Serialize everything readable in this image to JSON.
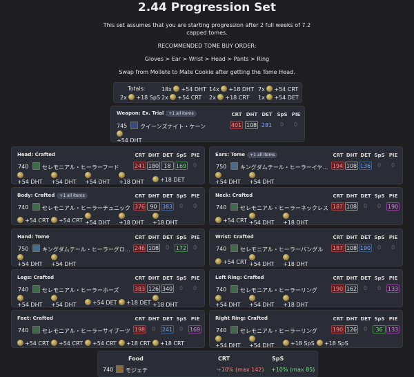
{
  "header": {
    "title": "2.44 Progression Set",
    "line1": "This set assumes that you are starting progression after 2 full weeks of 7.2",
    "line2": "capped tomes.",
    "line3": "RECOMMENDED TOME BUY ORDER:",
    "line4": "Gloves > Ear > Wrist > Head > Pants > Ring",
    "line5": "Swap from Mollete to Mate Cookie after getting the Tome Head."
  },
  "totals": {
    "label": "Totals:",
    "items": [
      "18x",
      "+54 DHT",
      "14x",
      "+18 DHT",
      "7x",
      "+54 CRT",
      "2x",
      "+18 SpS",
      "2x",
      "+54 CRT",
      "2x",
      "+18 CRT",
      "1x",
      "+54 DET"
    ]
  },
  "stat_headers": [
    "CRT",
    "DHT",
    "DET",
    "SpS",
    "PIE"
  ],
  "weapon": {
    "slot": "Weapon: Ex. Trial",
    "badge": "+1 all items",
    "ilvl": "745",
    "name": "クイーンズナイト・ケーン",
    "stats": [
      "401",
      "108",
      "281",
      "0",
      "0"
    ],
    "melds": [
      "+54 DHT"
    ]
  },
  "gear": [
    {
      "slot": "Head: Crafted",
      "ilvl": "740",
      "name": "セレモニアル・ヒーラーフード",
      "stats": [
        "241",
        "180",
        "18",
        "169",
        "0"
      ],
      "melds": [
        "+54 DHT",
        "+54 DHT",
        "+54 DHT",
        "+18 DHT",
        "+18 DET"
      ]
    },
    {
      "slot": "Ears: Tome",
      "badge": "+1 all items",
      "ilvl": "750",
      "name": "キングダムテール・ヒーラーイヤ…",
      "stats": [
        "194",
        "108",
        "136",
        "0",
        "0"
      ],
      "melds": [
        "+54 DHT",
        "+54 DHT"
      ]
    },
    {
      "slot": "Body: Crafted",
      "badge": "+1 all items",
      "ilvl": "740",
      "name": "セレモニアル・ヒーラーチュニック",
      "stats": [
        "376",
        "90",
        "383",
        "0",
        "0"
      ],
      "melds": [
        "+54 CRT",
        "+54 CRT",
        "+54 DHT",
        "+18 DHT",
        "+18 DHT"
      ]
    },
    {
      "slot": "Neck: Crafted",
      "ilvl": "740",
      "name": "セレモニアル・ヒーラーネックレス",
      "stats": [
        "187",
        "108",
        "0",
        "0",
        "190"
      ],
      "melds": [
        "+54 CRT",
        "+54 DHT",
        "+18 DHT"
      ]
    },
    {
      "slot": "Hand: Tome",
      "ilvl": "750",
      "name": "キングダムテール・ヒーラーグロ…",
      "stats": [
        "246",
        "108",
        "0",
        "172",
        "0"
      ],
      "melds": [
        "+54 DHT",
        "+54 DHT"
      ]
    },
    {
      "slot": "Wrist: Crafted",
      "ilvl": "740",
      "name": "セレモニアル・ヒーラーバングル",
      "stats": [
        "187",
        "108",
        "190",
        "0",
        "0"
      ],
      "melds": [
        "+54 CRT",
        "+54 DHT",
        "+18 DHT"
      ]
    },
    {
      "slot": "Legs: Crafted",
      "ilvl": "740",
      "name": "セレモニアル・ヒーラーホーズ",
      "stats": [
        "383",
        "126",
        "340",
        "0",
        "0"
      ],
      "melds": [
        "+54 DHT",
        "+54 DHT",
        "+54 DET",
        "+18 DET",
        "+18 DHT"
      ]
    },
    {
      "slot": "Left Ring: Crafted",
      "ilvl": "740",
      "name": "セレモニアル・ヒーラーリング",
      "stats": [
        "190",
        "162",
        "0",
        "0",
        "133"
      ],
      "melds": [
        "+54 DHT",
        "+54 DHT",
        "+18 DHT"
      ]
    },
    {
      "slot": "Feet: Crafted",
      "ilvl": "740",
      "name": "セレモニアル・ヒーラーサイブーツ",
      "stats": [
        "198",
        "0",
        "241",
        "0",
        "169"
      ],
      "melds": [
        "+54 CRT",
        "+54 CRT",
        "+54 CRT",
        "+18 CRT",
        "+18 CRT"
      ]
    },
    {
      "slot": "Right Ring: Crafted",
      "ilvl": "740",
      "name": "セレモニアル・ヒーラーリング",
      "stats": [
        "190",
        "126",
        "0",
        "36",
        "133"
      ],
      "melds": [
        "+54 DHT",
        "+54 DHT",
        "+18 SpS",
        "+18 SpS"
      ]
    }
  ],
  "food": {
    "hdr_food": "Food",
    "hdr_crt": "CRT",
    "hdr_sps": "SpS",
    "ilvl": "740",
    "name": "モジェテ",
    "crt": "+10% (max 142)",
    "sps": "+10% (max 85)"
  }
}
